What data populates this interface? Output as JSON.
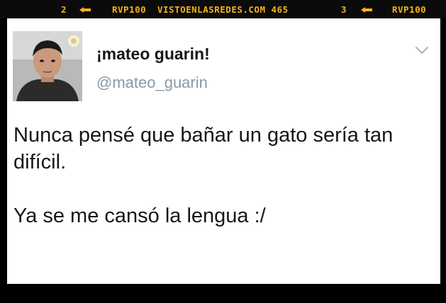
{
  "topbar": {
    "left_count": "2",
    "left_code": "RVP100",
    "site_text": "VISTOENLASREDES.COM 465",
    "right_count": "3",
    "right_code": "RVP100",
    "accent_color": "#f2b21c"
  },
  "tweet": {
    "display_name": "¡mateo guarin!",
    "handle": "@mateo_guarin",
    "menu_icon": "chevron-down-icon",
    "text_line1": "Nunca pensé que bañar un gato sería tan difícil.",
    "text_line2": "Ya se me cansó la lengua :/"
  }
}
